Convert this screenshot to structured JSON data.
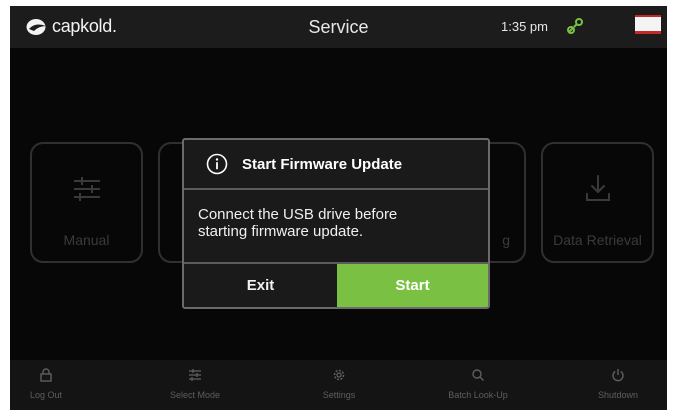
{
  "header": {
    "logo_text": "capkold.",
    "title": "Service",
    "time": "1:35 pm",
    "link_icon": "link-icon",
    "flag_icon": "flag-icon"
  },
  "tiles": [
    {
      "label": "Manual",
      "icon": "sliders-icon"
    },
    {
      "label": "",
      "icon": ""
    },
    {
      "label": "g",
      "icon": ""
    },
    {
      "label": "Data Retrieval",
      "icon": "download-icon"
    }
  ],
  "dialog": {
    "title": "Start Firmware Update",
    "icon": "info-icon",
    "message_line1": "Connect the USB drive before",
    "message_line2": "starting firmware update.",
    "exit_label": "Exit",
    "start_label": "Start"
  },
  "bottom_nav": [
    {
      "label": "Log Out",
      "icon": "lock-icon"
    },
    {
      "label": "Select Mode",
      "icon": "sliders-icon"
    },
    {
      "label": "Settings",
      "icon": "gear-icon"
    },
    {
      "label": "Batch Look-Up",
      "icon": "search-icon"
    },
    {
      "label": "Shutdown",
      "icon": "power-icon"
    }
  ],
  "colors": {
    "accent": "#7ac143",
    "background": "#0c0c0c",
    "dialog_bg": "#1a1a1a",
    "flag_red": "#c62828"
  }
}
